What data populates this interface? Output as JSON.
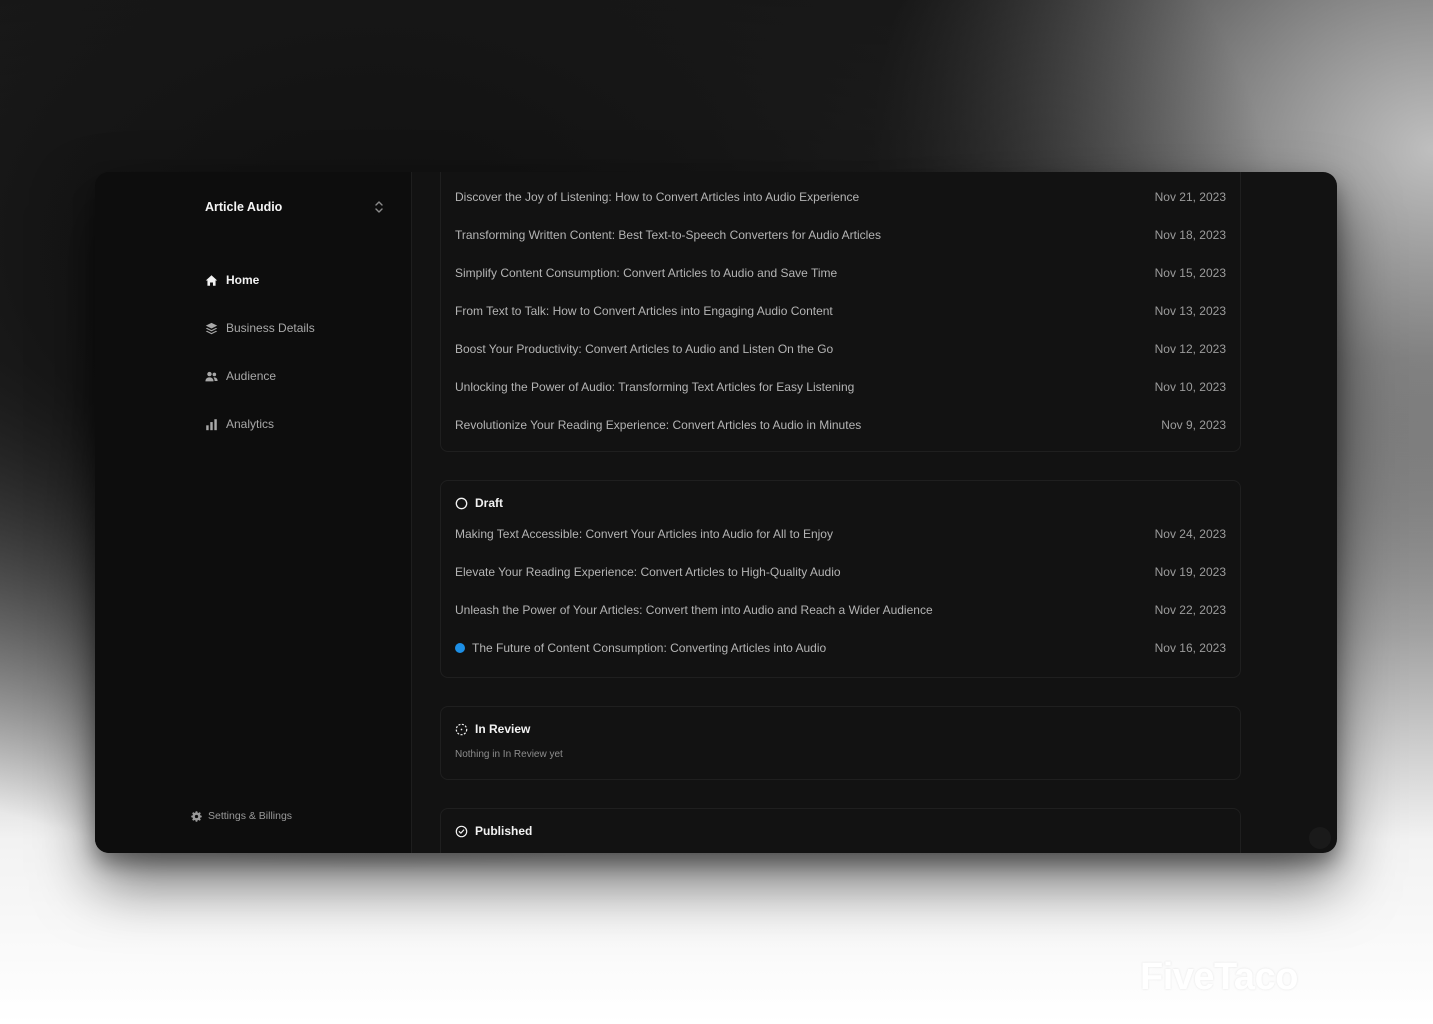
{
  "app": {
    "name": "Article Audio"
  },
  "sidebar": {
    "items": [
      {
        "label": "Home",
        "icon": "home-icon",
        "active": true
      },
      {
        "label": "Business Details",
        "icon": "layers-icon",
        "active": false
      },
      {
        "label": "Audience",
        "icon": "users-icon",
        "active": false
      },
      {
        "label": "Analytics",
        "icon": "bar-chart-icon",
        "active": false
      }
    ],
    "settings_label": "Settings & Billings"
  },
  "sections": {
    "scheduled": {
      "rows": [
        {
          "title": "Discover the Joy of Listening: How to Convert Articles into Audio Experience",
          "date": "Nov 21, 2023"
        },
        {
          "title": "Transforming Written Content: Best Text-to-Speech Converters for Audio Articles",
          "date": "Nov 18, 2023"
        },
        {
          "title": "Simplify Content Consumption: Convert Articles to Audio and Save Time",
          "date": "Nov 15, 2023"
        },
        {
          "title": "From Text to Talk: How to Convert Articles into Engaging Audio Content",
          "date": "Nov 13, 2023"
        },
        {
          "title": "Boost Your Productivity: Convert Articles to Audio and Listen On the Go",
          "date": "Nov 12, 2023"
        },
        {
          "title": "Unlocking the Power of Audio: Transforming Text Articles for Easy Listening",
          "date": "Nov 10, 2023"
        },
        {
          "title": "Revolutionize Your Reading Experience: Convert Articles to Audio in Minutes",
          "date": "Nov 9, 2023"
        }
      ]
    },
    "draft": {
      "label": "Draft",
      "rows": [
        {
          "title": "Making Text Accessible: Convert Your Articles into Audio for All to Enjoy",
          "date": "Nov 24, 2023"
        },
        {
          "title": "Elevate Your Reading Experience: Convert Articles to High-Quality Audio",
          "date": "Nov 19, 2023"
        },
        {
          "title": "Unleash the Power of Your Articles: Convert them into Audio and Reach a Wider Audience",
          "date": "Nov 22, 2023"
        },
        {
          "title": "The Future of Content Consumption: Converting Articles into Audio",
          "date": "Nov 16, 2023",
          "unread": true
        }
      ]
    },
    "in_review": {
      "label": "In Review",
      "empty_text": "Nothing in In Review yet"
    },
    "published": {
      "label": "Published"
    }
  },
  "colors": {
    "accent_dot": "#1d8fe6",
    "window_bg": "#121212",
    "sidebar_bg": "#0d0d0d"
  },
  "watermark": "FiveTaco"
}
